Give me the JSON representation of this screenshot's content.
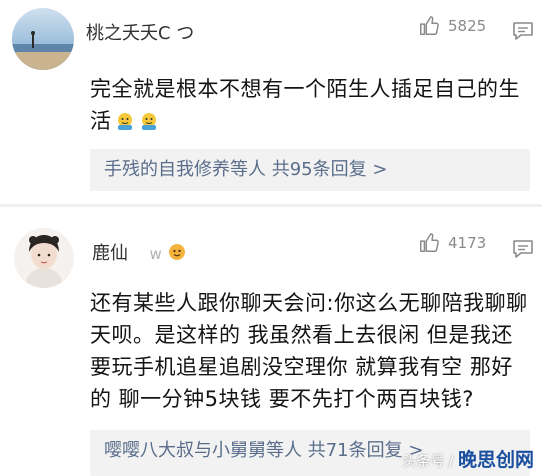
{
  "comments": [
    {
      "username": "桃之夭夭C  つ",
      "like_count": "5825",
      "body": "完全就是根本不想有一个陌生人插足自己的生活",
      "emoji_count": 2,
      "reply_summary": "手残的自我修养等人  共95条回复 >"
    },
    {
      "username": "鹿仙",
      "username_suffix": "w",
      "like_count": "4173",
      "body": "还有某些人跟你聊天会问:你这么无聊陪我聊聊天呗。是这样的 我虽然看上去很闲 但是我还要玩手机追星追剧没空理你 就算我有空 那好的 聊一分钟5块钱 要不先打个两百块钱?",
      "reply_summary": "嘤嘤八大叔与小舅舅等人  共71条回复 >"
    }
  ],
  "watermark": {
    "prefix": "头条号 / ",
    "brand": "晚思创网"
  },
  "colors": {
    "reply_link": "#5a6e8c",
    "reply_bg": "#f2f2f2",
    "meta_gray": "#8a8a8a"
  }
}
